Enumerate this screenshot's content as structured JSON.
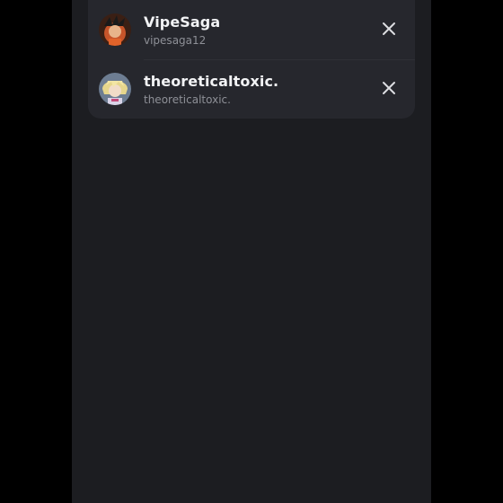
{
  "recent_users": [
    {
      "display_name": "VipeSaga",
      "username": "vipesaga12",
      "avatar_icon": "orange-anime-avatar-icon",
      "remove_icon": "close-icon"
    },
    {
      "display_name": "theoreticaltoxic.",
      "username": "theoreticaltoxic.",
      "avatar_icon": "blonde-anime-avatar-icon",
      "remove_icon": "close-icon"
    }
  ],
  "colors": {
    "background": "#1c1d21",
    "card": "#26272d",
    "name_text": "#f2f3f5",
    "username_text": "#8e9097",
    "close_icon": "#dcdde1"
  }
}
